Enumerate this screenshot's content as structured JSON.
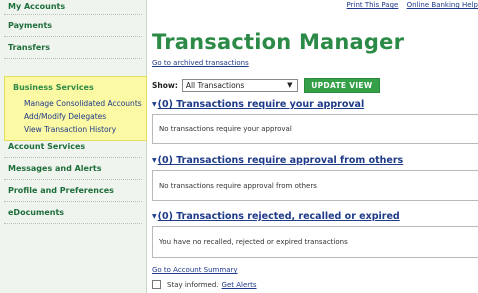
{
  "sidebar": {
    "items": [
      {
        "label": "My Accounts"
      },
      {
        "label": "Payments"
      },
      {
        "label": "Transfers"
      }
    ],
    "business_services": {
      "title": "Business Services",
      "subitems": [
        {
          "label": "Manage Consolidated Accounts"
        },
        {
          "label": "Add/Modify Delegates"
        },
        {
          "label": "View Transaction History"
        }
      ]
    },
    "items_after": [
      {
        "label": "Account Services"
      },
      {
        "label": "Messages and Alerts"
      },
      {
        "label": "Profile and Preferences"
      },
      {
        "label": "eDocuments"
      }
    ]
  },
  "top_links": {
    "print": "Print This Page",
    "help": "Online Banking Help"
  },
  "page_title": "Transaction Manager",
  "archived_link": "Go to archived transactions",
  "filter": {
    "label": "Show:",
    "selected": "All Transactions",
    "button": "UPDATE VIEW"
  },
  "sections": [
    {
      "heading": "(0) Transactions require your approval",
      "message": "No transactions require your approval"
    },
    {
      "heading": "(0) Transactions require approval from others",
      "message": "No transactions require approval from others"
    },
    {
      "heading": "(0) Transactions rejected, recalled or expired",
      "message": "You have no recalled, rejected or expired transactions"
    }
  ],
  "account_summary_link": "Go to Account Summary",
  "stay_informed": {
    "text": "Stay informed.",
    "link": "Get Alerts"
  },
  "colors": {
    "accent_green": "#2a8a46",
    "link_blue": "#1e3a8a",
    "highlight_yellow": "#fbf9a3",
    "button_green": "#35a047"
  }
}
